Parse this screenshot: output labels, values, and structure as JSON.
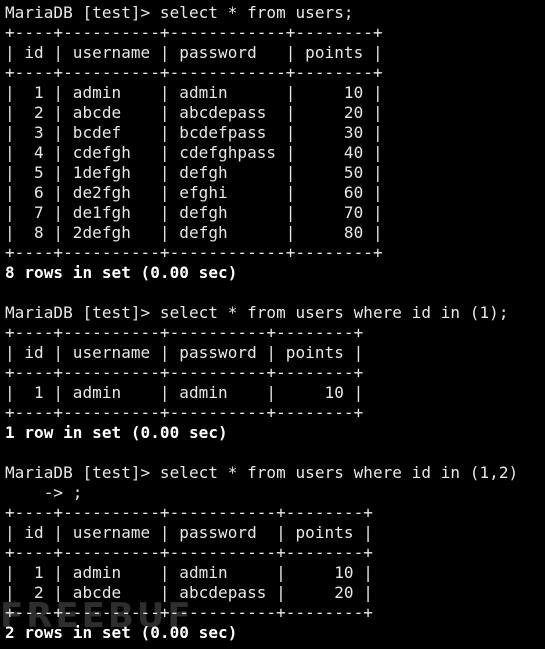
{
  "terminal": {
    "lines": [
      "MariaDB [test]> select * from users;",
      "+----+----------+------------+--------+",
      "| id | username | password   | points |",
      "+----+----------+------------+--------+",
      "|  1 | admin    | admin      |     10 |",
      "|  2 | abcde    | abcdepass  |     20 |",
      "|  3 | bcdef    | bcdefpass  |     30 |",
      "|  4 | cdefgh   | cdefghpass |     40 |",
      "|  5 | 1defgh   | defgh      |     50 |",
      "|  6 | de2fgh   | efghi      |     60 |",
      "|  7 | de1fgh   | defgh      |     70 |",
      "|  8 | 2defgh   | defgh      |     80 |",
      "+----+----------+------------+--------+",
      "8 rows in set (0.00 sec)",
      "",
      "MariaDB [test]> select * from users where id in (1);",
      "+----+----------+----------+--------+",
      "| id | username | password | points |",
      "+----+----------+----------+--------+",
      "|  1 | admin    | admin    |     10 |",
      "+----+----------+----------+--------+",
      "1 row in set (0.00 sec)",
      "",
      "MariaDB [test]> select * from users where id in (1,2)",
      "    -> ;",
      "+----+----------+-----------+--------+",
      "| id | username | password  | points |",
      "+----+----------+-----------+--------+",
      "|  1 | admin    | admin     |     10 |",
      "|  2 | abcde    | abcdepass |     20 |",
      "+----+----------+-----------+--------+",
      "2 rows in set (0.00 sec)"
    ]
  },
  "watermark": {
    "text": "FREEBUF"
  }
}
